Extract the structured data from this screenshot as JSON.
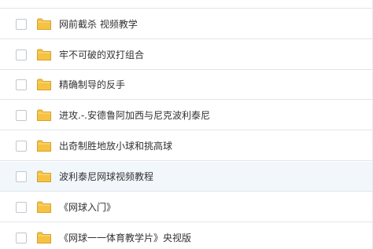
{
  "file_list": {
    "rows": [
      {
        "name": "网前截杀  视频教学",
        "icon": "folder-icon"
      },
      {
        "name": "牢不可破的双打组合",
        "icon": "folder-icon"
      },
      {
        "name": "精确制导的反手",
        "icon": "folder-icon"
      },
      {
        "name": "进攻.-.安德鲁阿加西与尼克波利泰尼",
        "icon": "folder-icon"
      },
      {
        "name": "出奇制胜地放小球和挑高球",
        "icon": "folder-icon"
      },
      {
        "name": "波利泰尼网球视频教程",
        "icon": "folder-icon",
        "hovered": true
      },
      {
        "name": "《网球入门》",
        "icon": "folder-icon"
      },
      {
        "name": "《网球一一体育教学片》央视版",
        "icon": "folder-icon"
      }
    ]
  },
  "colors": {
    "folder_fill": "#f5c242",
    "folder_tab": "#e8ae2a",
    "row_hover": "#f2f7fc",
    "divider": "#e1e5ea",
    "text": "#333333"
  }
}
